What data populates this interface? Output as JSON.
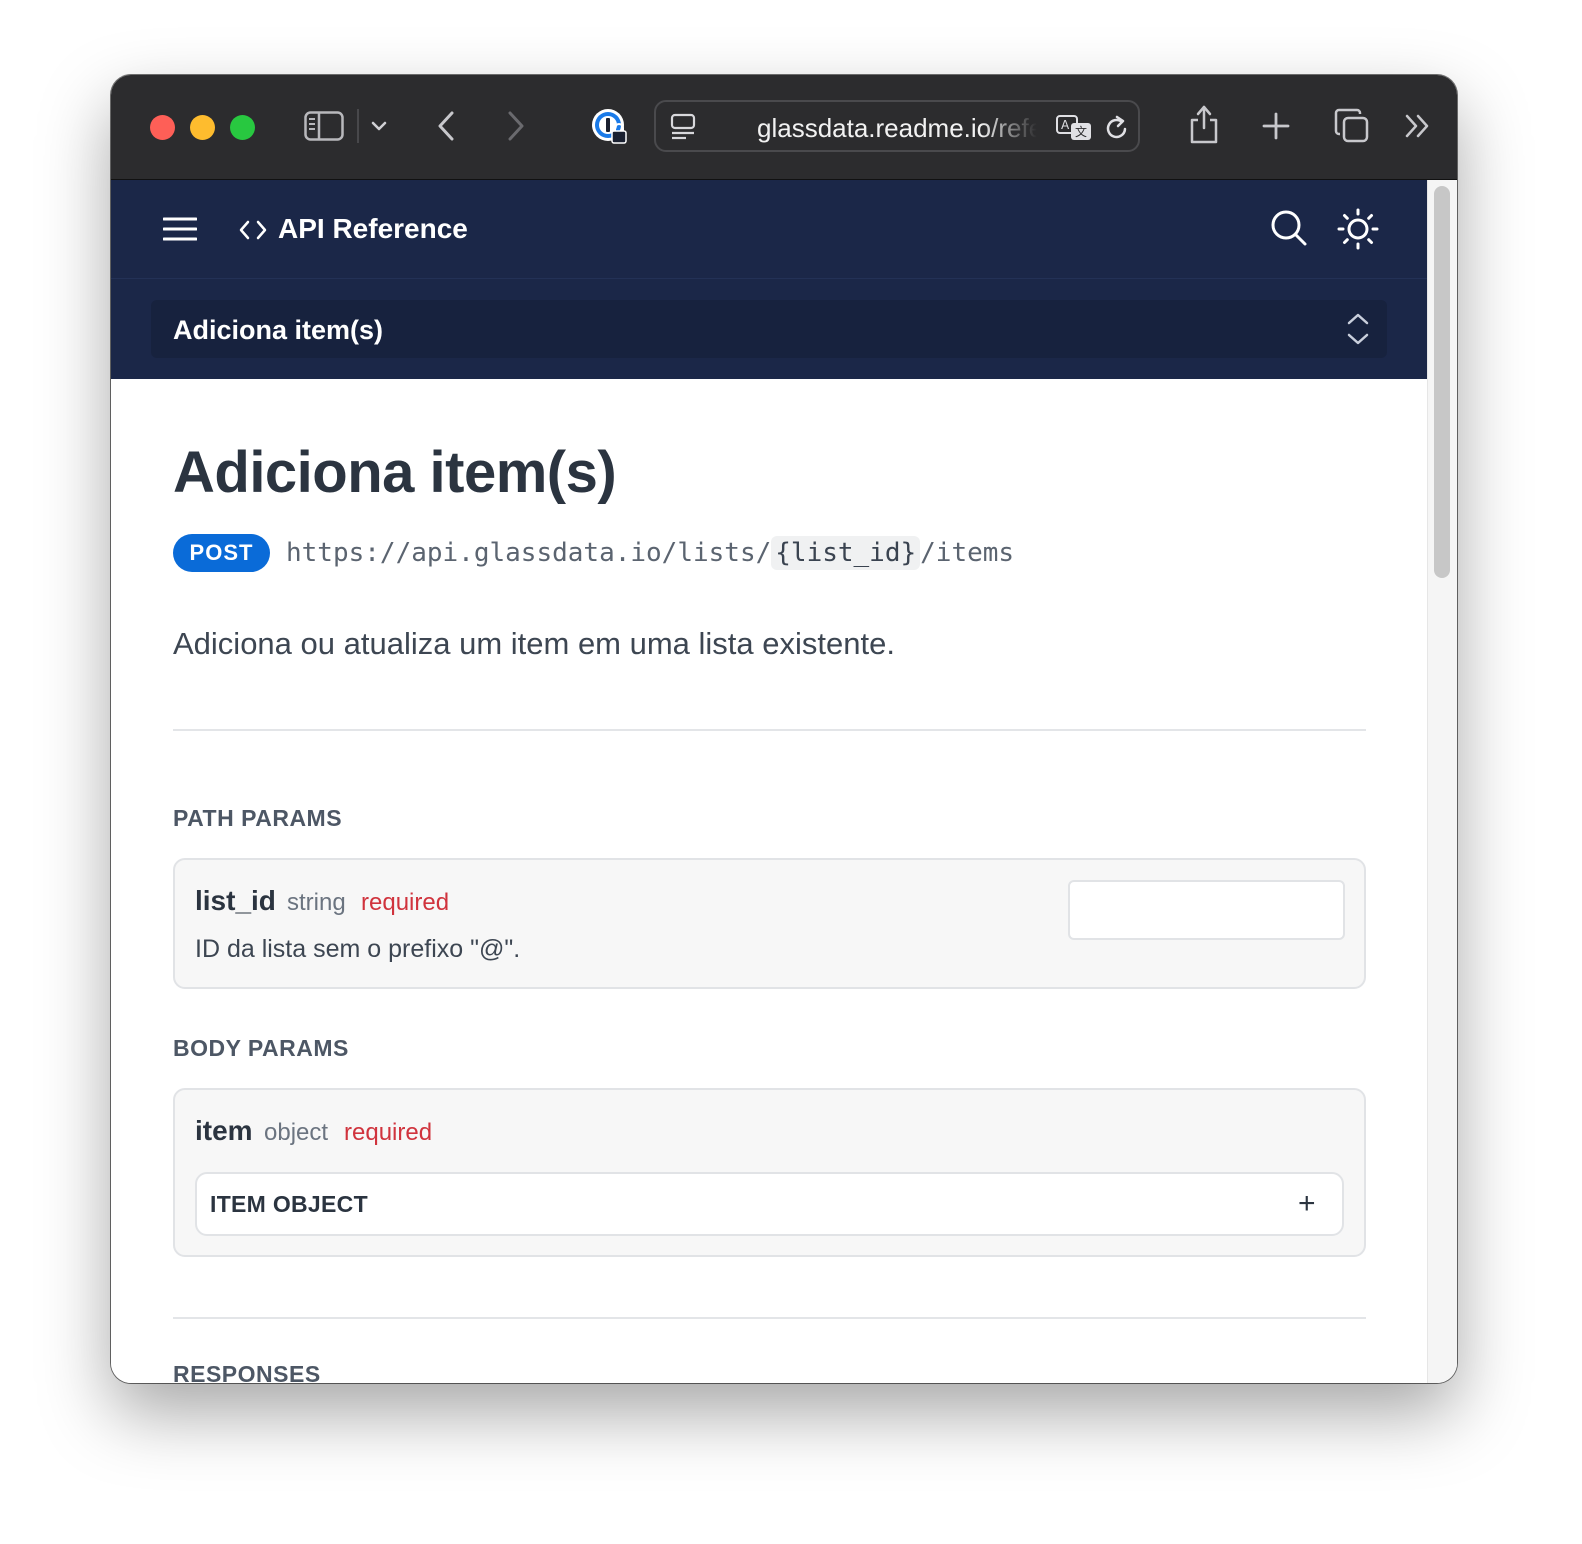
{
  "browser": {
    "url": "glassdata.readme.io/reference/adiciona-items"
  },
  "header": {
    "title": "API Reference",
    "selected_page": "Adiciona item(s)"
  },
  "page": {
    "title": "Adiciona item(s)",
    "method": "POST",
    "endpoint_prefix": "https://api.glassdata.io/lists/",
    "endpoint_param": "{list_id}",
    "endpoint_suffix": "/items",
    "description": "Adiciona ou atualiza um item em uma lista existente."
  },
  "path_params": {
    "heading": "PATH PARAMS",
    "params": [
      {
        "name": "list_id",
        "type": "string",
        "required": "required",
        "description": "ID da lista sem o prefixo \"@\".",
        "value": ""
      }
    ]
  },
  "body_params": {
    "heading": "BODY PARAMS",
    "params": [
      {
        "name": "item",
        "type": "object",
        "required": "required",
        "object_label": "ITEM OBJECT",
        "expand_symbol": "+"
      }
    ]
  },
  "responses": {
    "heading": "RESPONSES"
  },
  "colors": {
    "nav_bg": "#1b2748",
    "post_badge": "#0a6bd8",
    "required": "#d0333d"
  }
}
